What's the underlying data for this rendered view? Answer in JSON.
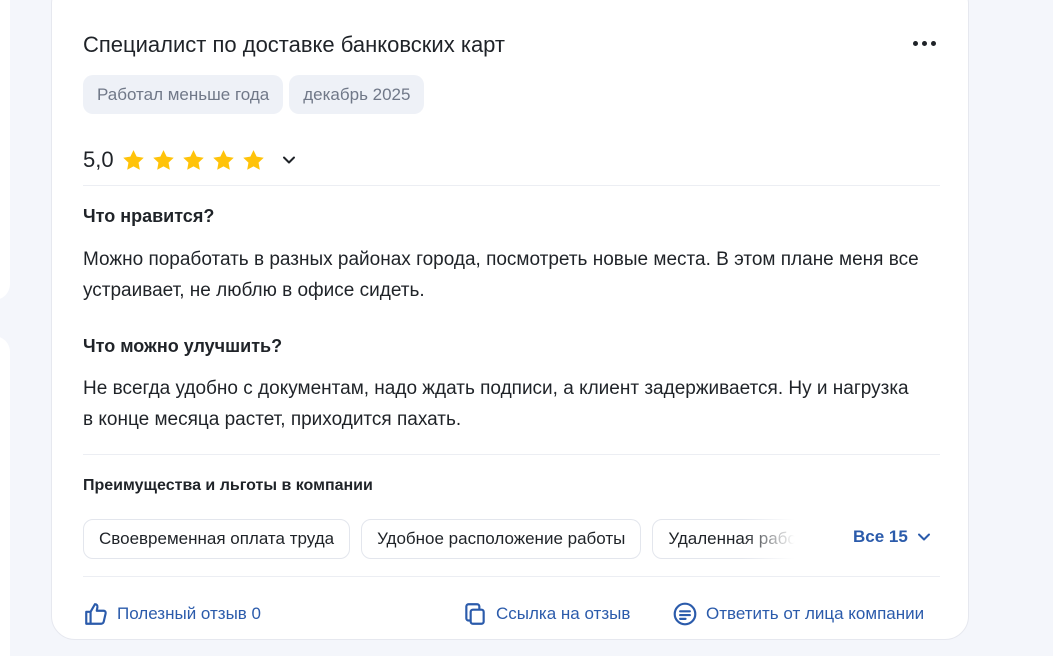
{
  "review": {
    "title": "Специалист по доставке банковских карт",
    "tags": [
      "Работал меньше года",
      "декабрь 2025"
    ],
    "rating": {
      "value": "5,0",
      "stars": 5,
      "star_color": "#ffc30a"
    },
    "likes": {
      "title": "Что нравится?",
      "text": "Можно поработать в разных районах города, посмотреть новые места. В этом плане меня все устраивает, не люблю в офисе сидеть."
    },
    "improve": {
      "title": "Что можно улучшить?",
      "text": "Не всегда удобно с документам, надо ждать подписи, а клиент задерживается. Ну и нагрузка в конце месяца растет, приходится пахать."
    },
    "benefits": {
      "title": "Преимущества и льготы в компании",
      "items": [
        "Своевременная оплата труда",
        "Удобное расположение работы",
        "Удаленная работа"
      ],
      "all_label": "Все 15"
    },
    "actions": {
      "helpful": "Полезный отзыв 0",
      "link": "Ссылка на отзыв",
      "reply": "Ответить от лица компании"
    }
  },
  "icons": {
    "more": "more-horizontal-icon",
    "star": "star-icon",
    "expand": "chevron-down-icon",
    "thumbs_up": "thumbs-up-icon",
    "copy_link": "copy-icon",
    "reply": "message-icon"
  },
  "colors": {
    "accent": "#2b5bab",
    "tag_bg": "#eef1f7",
    "tag_text": "#707888",
    "star": "#ffc30a"
  }
}
